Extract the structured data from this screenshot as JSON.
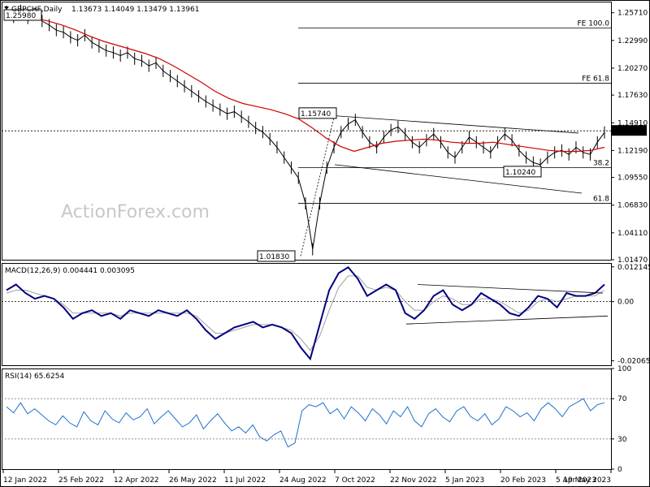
{
  "header": {
    "symbol": "GBPCHF,Daily",
    "ohlc": "1.13673 1.14049 1.13479 1.13961"
  },
  "watermark": "ActionForex.com",
  "chart_data": [
    {
      "type": "line",
      "panel": "price",
      "title": "GBPCHF,Daily",
      "y_axis_ticks": [
        "1.25710",
        "1.22990",
        "1.20270",
        "1.17630",
        "1.14910",
        "1.12190",
        "1.09550",
        "1.06830",
        "1.04110",
        "1.01470"
      ],
      "ylim": [
        1.0147,
        1.268
      ],
      "x_axis_ticks": [
        "12 Jan 2022",
        "25 Feb 2022",
        "12 Apr 2022",
        "26 May 2022",
        "11 Jul 2022",
        "24 Aug 2022",
        "7 Oct 2022",
        "22 Nov 2022",
        "5 Jan 2023",
        "20 Feb 2023",
        "5 Apr 2023",
        "19 May 2023"
      ],
      "series": [
        {
          "values": [
            1.258,
            1.253,
            1.259,
            1.252,
            1.256,
            1.249,
            1.245,
            1.24,
            1.238,
            1.233,
            1.23,
            1.235,
            1.228,
            1.224,
            1.22,
            1.218,
            1.215,
            1.218,
            1.212,
            1.21,
            1.205,
            1.208,
            1.2,
            1.195,
            1.19,
            1.185,
            1.18,
            1.175,
            1.17,
            1.166,
            1.162,
            1.158,
            1.16,
            1.155,
            1.15,
            1.144,
            1.14,
            1.133,
            1.125,
            1.115,
            1.105,
            1.095,
            1.07,
            1.025,
            1.07,
            1.105,
            1.125,
            1.14,
            1.148,
            1.152,
            1.14,
            1.13,
            1.125,
            1.135,
            1.142,
            1.145,
            1.138,
            1.13,
            1.125,
            1.132,
            1.138,
            1.13,
            1.12,
            1.115,
            1.125,
            1.135,
            1.13,
            1.125,
            1.12,
            1.13,
            1.138,
            1.132,
            1.122,
            1.115,
            1.11,
            1.108,
            1.115,
            1.12,
            1.122,
            1.118,
            1.125,
            1.12,
            1.118,
            1.13,
            1.1396
          ]
        },
        {
          "values": [
            1.256,
            1.254,
            1.252,
            1.249,
            1.245,
            1.24,
            1.234,
            1.229,
            1.225,
            1.221,
            1.217,
            1.212,
            1.205,
            1.197,
            1.189,
            1.18,
            1.173,
            1.168,
            1.165,
            1.162,
            1.158,
            1.153,
            1.144,
            1.134,
            1.126,
            1.121,
            1.125,
            1.129,
            1.131,
            1.132,
            1.133,
            1.132,
            1.13,
            1.129,
            1.129,
            1.13,
            1.128,
            1.126,
            1.124,
            1.122,
            1.121,
            1.121,
            1.122,
            1.125
          ]
        }
      ],
      "annotations": [
        {
          "text": "1.25980",
          "price": 1.2598
        },
        {
          "text": "1.15740",
          "price": 1.1574
        },
        {
          "text": "1.01830",
          "price": 1.0183
        },
        {
          "text": "1.10240",
          "price": 1.1024
        },
        {
          "text": "1.14120",
          "price": 1.1412
        },
        {
          "text": "FE 100.0",
          "price": 1.242
        },
        {
          "text": "FE 61.8",
          "price": 1.188
        },
        {
          "text": "38.2",
          "price": 1.105
        },
        {
          "text": "61.8",
          "price": 1.07
        }
      ]
    },
    {
      "type": "line",
      "panel": "macd",
      "title": "MACD(12,26,9) 0.004441 0.003095",
      "y_axis_ticks": [
        "0.012145",
        "0.00",
        "-0.020656"
      ],
      "ylim": [
        -0.0222,
        0.0135
      ],
      "series": [
        {
          "values": [
            0.004,
            0.006,
            0.003,
            0.001,
            0.002,
            0.001,
            -0.002,
            -0.006,
            -0.004,
            -0.003,
            -0.005,
            -0.004,
            -0.006,
            -0.003,
            -0.004,
            -0.005,
            -0.003,
            -0.004,
            -0.005,
            -0.003,
            -0.006,
            -0.01,
            -0.013,
            -0.011,
            -0.009,
            -0.008,
            -0.007,
            -0.009,
            -0.008,
            -0.009,
            -0.011,
            -0.016,
            -0.02,
            -0.008,
            0.004,
            0.01,
            0.012,
            0.008,
            0.002,
            0.004,
            0.006,
            0.004,
            -0.004,
            -0.006,
            -0.003,
            0.002,
            0.004,
            -0.001,
            -0.003,
            -0.001,
            0.003,
            0.001,
            -0.001,
            -0.004,
            -0.005,
            -0.002,
            0.002,
            0.001,
            -0.002,
            0.003,
            0.002,
            0.002,
            0.003,
            0.006
          ]
        },
        {
          "values": [
            0.003,
            0.004,
            0.004,
            0.003,
            0.002,
            0.001,
            -0.001,
            -0.004,
            -0.004,
            -0.004,
            -0.004,
            -0.004,
            -0.005,
            -0.004,
            -0.004,
            -0.004,
            -0.004,
            -0.004,
            -0.004,
            -0.004,
            -0.005,
            -0.008,
            -0.011,
            -0.011,
            -0.01,
            -0.009,
            -0.008,
            -0.008,
            -0.008,
            -0.009,
            -0.01,
            -0.013,
            -0.017,
            -0.012,
            -0.003,
            0.005,
            0.009,
            0.009,
            0.005,
            0.004,
            0.005,
            0.004,
            0.0,
            -0.003,
            -0.003,
            0.0,
            0.002,
            0.001,
            -0.001,
            -0.001,
            0.001,
            0.001,
            0.0,
            -0.002,
            -0.004,
            -0.003,
            0.0,
            0.001,
            0.0,
            0.001,
            0.002,
            0.002,
            0.002,
            0.004
          ]
        }
      ]
    },
    {
      "type": "line",
      "panel": "rsi",
      "title": "RSI(14) 65.6254",
      "y_axis_ticks": [
        "100",
        "70",
        "30",
        "0"
      ],
      "ylim": [
        0,
        100
      ],
      "series": [
        {
          "values": [
            62,
            56,
            66,
            55,
            60,
            54,
            48,
            44,
            53,
            46,
            42,
            57,
            48,
            44,
            58,
            50,
            46,
            56,
            49,
            52,
            60,
            45,
            52,
            58,
            50,
            42,
            46,
            54,
            40,
            48,
            55,
            46,
            38,
            42,
            36,
            44,
            32,
            28,
            34,
            38,
            22,
            26,
            58,
            64,
            62,
            66,
            55,
            60,
            50,
            62,
            56,
            48,
            60,
            54,
            45,
            58,
            52,
            62,
            48,
            42,
            55,
            60,
            52,
            47,
            58,
            62,
            52,
            48,
            55,
            44,
            50,
            62,
            58,
            52,
            56,
            48,
            60,
            66,
            60,
            52,
            62,
            66,
            70,
            58,
            64,
            66
          ]
        }
      ]
    }
  ]
}
